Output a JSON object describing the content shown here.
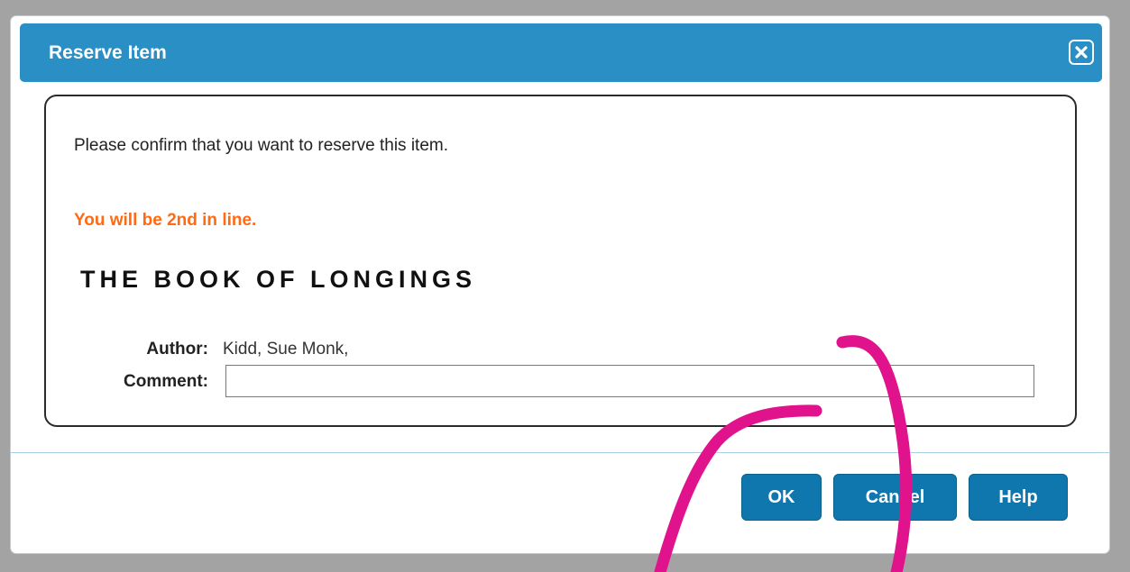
{
  "dialog": {
    "title": "Reserve Item",
    "close_icon": "close-icon",
    "confirm_message": "Please confirm that you want to reserve this item.",
    "line_message": "You will be 2nd in line.",
    "book_title": "THE BOOK OF LONGINGS",
    "author_label": "Author:",
    "author_value": "Kidd, Sue Monk,",
    "comment_label": "Comment:",
    "comment_value": ""
  },
  "buttons": {
    "ok": "OK",
    "cancel": "Cancel",
    "help": "Help"
  },
  "colors": {
    "titlebar": "#2a8fc4",
    "button": "#0f77ad",
    "highlight_text": "#ff6a13",
    "annotation": "#e0138c"
  }
}
